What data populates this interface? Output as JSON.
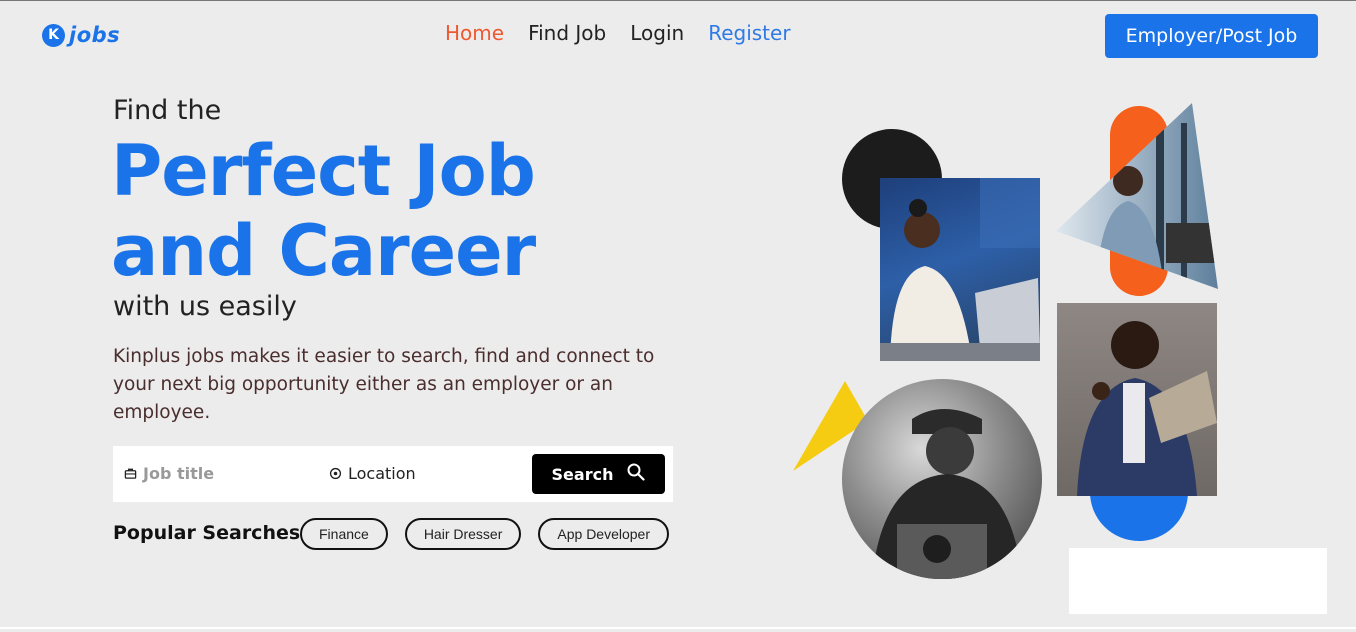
{
  "header": {
    "logo_mark": "K",
    "logo_text": "jobs",
    "nav": [
      {
        "label": "Home"
      },
      {
        "label": "Find Job"
      },
      {
        "label": "Login"
      },
      {
        "label": "Register"
      }
    ],
    "cta_label": "Employer/Post Job"
  },
  "hero": {
    "pre_title": "Find the",
    "title_line1": "Perfect Job",
    "title_line2": "and Career",
    "post_title": "with us easily",
    "description": "Kinplus jobs makes it easier to search, find and connect to your next big opportunity either as an employer or an employee."
  },
  "search": {
    "job_placeholder": "Job title",
    "location_placeholder": "Location",
    "button_label": "Search"
  },
  "popular": {
    "label": "Popular Searches",
    "items": [
      "Finance",
      "Hair Dresser",
      "App Developer"
    ]
  },
  "colors": {
    "brand_blue": "#1a73e8",
    "accent_orange": "#f0582f",
    "yellow": "#f5c518",
    "background": "#ececec"
  }
}
